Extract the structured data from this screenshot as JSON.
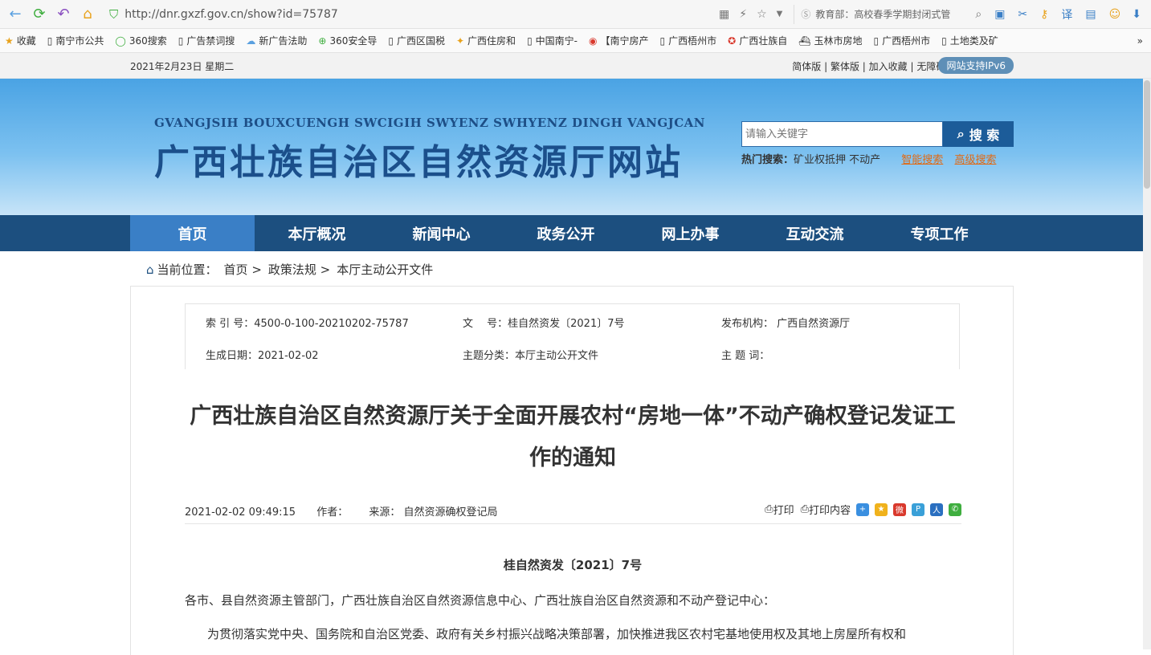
{
  "browser": {
    "url": "http://dnr.gxzf.gov.cn/show?id=75787",
    "search_text": "教育部：高校春季学期封闭式管",
    "bookmarks": [
      "收藏",
      "南宁市公共",
      "360搜索",
      "广告禁词搜",
      "新广告法助",
      "360安全导",
      "广西区国税",
      "广西住房和",
      "中国南宁-",
      "【南宁房产",
      "广西梧州市",
      "广西壮族自",
      "玉林市房地",
      "广西梧州市",
      "土地类及矿"
    ]
  },
  "topbar": {
    "date": "2021年2月23日 星期二",
    "links": "简体版 | 繁体版 | 加入收藏 | 无障碍阅读 | 登录",
    "ipv6": "网站支持IPv6"
  },
  "banner": {
    "en_title": "GVANGJSIH BOUXCUENGH SWCIGIH SWYENZ SWHYENZ DINGH VANGJCAN",
    "cn_title": "广西壮族自治区自然资源厅网站",
    "search_placeholder": "请输入关键字",
    "search_button": "搜 索",
    "hot_label": "热门搜索：",
    "hot_terms": "矿业权抵押  不动产",
    "smart_search": "智能搜索",
    "advanced_search": "高级搜索"
  },
  "nav": [
    "首页",
    "本厅概况",
    "新闻中心",
    "政务公开",
    "网上办事",
    "互动交流",
    "专项工作"
  ],
  "breadcrumb": {
    "label": "当前位置：",
    "items": [
      "首页 >",
      "政策法规 >",
      "本厅主动公开文件"
    ]
  },
  "meta": {
    "index_no": "索 引 号：4500-0-100-20210202-75787",
    "doc_no": "文　 号：桂自然资发〔2021〕7号",
    "publisher": "发布机构： 广西自然资源厅",
    "created": "生成日期：2021-02-02",
    "topic": "主题分类：本厅主动公开文件",
    "keywords": "主 题 词："
  },
  "article": {
    "title": "广西壮族自治区自然资源厅关于全面开展农村“房地一体”不动产确权登记发证工作的通知",
    "datetime": "2021-02-02 09:49:15",
    "author": "作者：",
    "source": "来源： 自然资源确权登记局",
    "print": "打印",
    "print_content": "打印内容",
    "doc_number": "桂自然资发〔2021〕7号",
    "para1": "各市、县自然资源主管部门，广西壮族自治区自然资源信息中心、广西壮族自治区自然资源和不动产登记中心：",
    "para2": "为贯彻落实党中央、国务院和自治区党委、政府有关乡村振兴战略决策部署，加快推进我区农村宅基地使用权及其地上房屋所有权和"
  },
  "colors": {
    "nav_bg": "#1c4f7f",
    "nav_active": "#3a7fc6",
    "accent_orange": "#e06a15"
  }
}
